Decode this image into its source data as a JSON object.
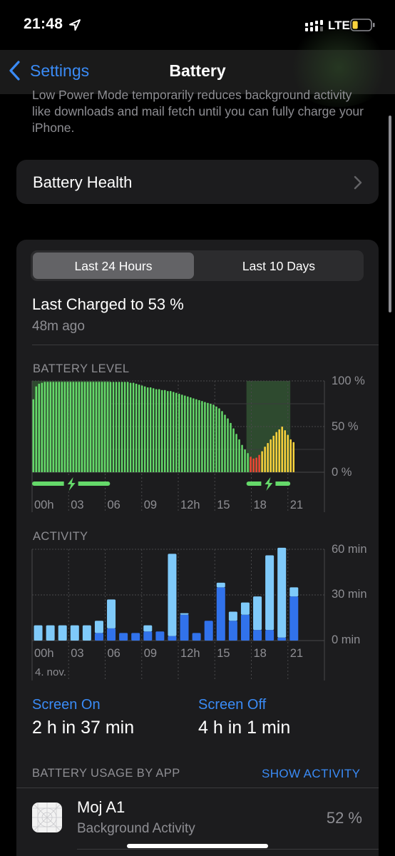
{
  "status": {
    "time": "21:48",
    "network": "LTE",
    "icons": [
      "location-arrow-icon",
      "signal-icon",
      "battery-icon"
    ],
    "battery_level": 0.3
  },
  "nav": {
    "back_label": "Settings",
    "title": "Battery"
  },
  "low_power_text": "Low Power Mode temporarily reduces background activity like downloads and mail fetch until you can fully charge your iPhone.",
  "battery_health": {
    "label": "Battery Health"
  },
  "segments": {
    "left": "Last 24 Hours",
    "right": "Last 10 Days",
    "selected": "left"
  },
  "last_charged": {
    "title": "Last Charged to 53 %",
    "ago": "48m ago"
  },
  "colors": {
    "accent": "#3a8bf6",
    "battery_green": "#65d96a",
    "battery_red": "#ef4634",
    "battery_yellow": "#fbd33d",
    "charging_bg": "#2e4a2f",
    "screen_on": "#7fcafa",
    "screen_off": "#3172eb"
  },
  "chart_data": [
    {
      "type": "bar",
      "title": "BATTERY LEVEL",
      "x_tick_labels": [
        "00h",
        "03",
        "06",
        "09",
        "12h",
        "15",
        "18",
        "21"
      ],
      "y_tick_labels": [
        "100 %",
        "50 %",
        "0 %"
      ],
      "ylim": [
        0,
        100
      ],
      "legend": "none",
      "grid": true,
      "values": [
        80,
        94,
        97,
        98,
        99,
        99,
        99,
        99,
        99,
        99,
        99,
        99,
        99,
        99,
        99,
        99,
        99,
        99,
        99,
        99,
        99,
        99,
        99,
        99,
        99,
        99,
        99,
        99,
        99,
        99,
        99,
        99,
        99,
        99,
        98,
        98,
        97,
        96,
        95,
        94,
        93,
        93,
        92,
        91,
        91,
        90,
        90,
        89,
        89,
        88,
        87,
        86,
        85,
        84,
        83,
        82,
        81,
        80,
        79,
        78,
        77,
        76,
        75,
        74,
        72,
        70,
        67,
        63,
        59,
        54,
        48,
        42,
        36,
        30,
        25,
        21,
        17,
        15,
        16,
        19,
        23,
        28,
        32,
        36,
        40,
        44,
        47,
        50,
        46,
        41,
        36,
        33
      ],
      "bar_colors": [
        "green",
        "green",
        "green",
        "green",
        "green",
        "green",
        "green",
        "green",
        "green",
        "green",
        "green",
        "green",
        "green",
        "green",
        "green",
        "green",
        "green",
        "green",
        "green",
        "green",
        "green",
        "green",
        "green",
        "green",
        "green",
        "green",
        "green",
        "green",
        "green",
        "green",
        "green",
        "green",
        "green",
        "green",
        "green",
        "green",
        "green",
        "green",
        "green",
        "green",
        "green",
        "green",
        "green",
        "green",
        "green",
        "green",
        "green",
        "green",
        "green",
        "green",
        "green",
        "green",
        "green",
        "green",
        "green",
        "green",
        "green",
        "green",
        "green",
        "green",
        "green",
        "green",
        "green",
        "green",
        "green",
        "green",
        "green",
        "green",
        "green",
        "green",
        "green",
        "green",
        "green",
        "green",
        "green",
        "green",
        "red",
        "red",
        "red",
        "red",
        "yellow",
        "yellow",
        "yellow",
        "yellow",
        "yellow",
        "yellow",
        "yellow",
        "yellow",
        "yellow",
        "yellow",
        "yellow",
        "yellow"
      ],
      "charging_periods_hours": [
        [
          0,
          6.4
        ],
        [
          17.6,
          21.2
        ]
      ]
    },
    {
      "type": "bar",
      "title": "ACTIVITY",
      "stacked": true,
      "x_tick_labels": [
        "00h",
        "03",
        "06",
        "09",
        "12h",
        "15",
        "18",
        "21"
      ],
      "date_label": "4. nov.",
      "y_tick_labels": [
        "60 min",
        "30 min",
        "0 min"
      ],
      "ylim": [
        0,
        60
      ],
      "legend": "none",
      "grid": true,
      "series": [
        {
          "name": "Screen On",
          "color_key": "screen_on",
          "values": [
            0,
            0,
            0,
            0,
            0,
            0,
            0,
            0,
            0,
            0,
            0,
            0,
            0,
            0,
            0,
            0,
            0,
            0,
            0,
            0,
            0,
            0
          ]
        },
        {
          "name": "Screen Off",
          "color_key": "screen_off",
          "values": [
            0,
            0,
            0,
            0,
            0,
            0,
            0,
            0,
            0,
            0,
            0,
            0,
            0,
            0,
            0,
            0,
            0,
            0,
            0,
            0,
            0,
            0
          ]
        }
      ],
      "hours": [
        0,
        1,
        2,
        3,
        4,
        5,
        6,
        7,
        8,
        9,
        10,
        11,
        12,
        13,
        14,
        15,
        16,
        17,
        18,
        19,
        20,
        21
      ],
      "screen_on_minutes": [
        10,
        10,
        10,
        10,
        10,
        8,
        19,
        0,
        0,
        4,
        0,
        54,
        1,
        0,
        0,
        3,
        6,
        8,
        22,
        49,
        59,
        6
      ],
      "screen_off_minutes": [
        0,
        0,
        0,
        0,
        0,
        5,
        8,
        5,
        5,
        6,
        6,
        3,
        17,
        5,
        13,
        35,
        13,
        17,
        7,
        7,
        2,
        29
      ]
    }
  ],
  "screen_time": {
    "on_label": "Screen On",
    "on_value": "2 h in 37 min",
    "off_label": "Screen Off",
    "off_value": "4 h in 1 min"
  },
  "usage": {
    "header": "BATTERY USAGE BY APP",
    "show_activity": "SHOW ACTIVITY",
    "apps": [
      {
        "name": "Moj A1",
        "subtitle": "Background Activity",
        "percent": "52 %"
      }
    ]
  }
}
